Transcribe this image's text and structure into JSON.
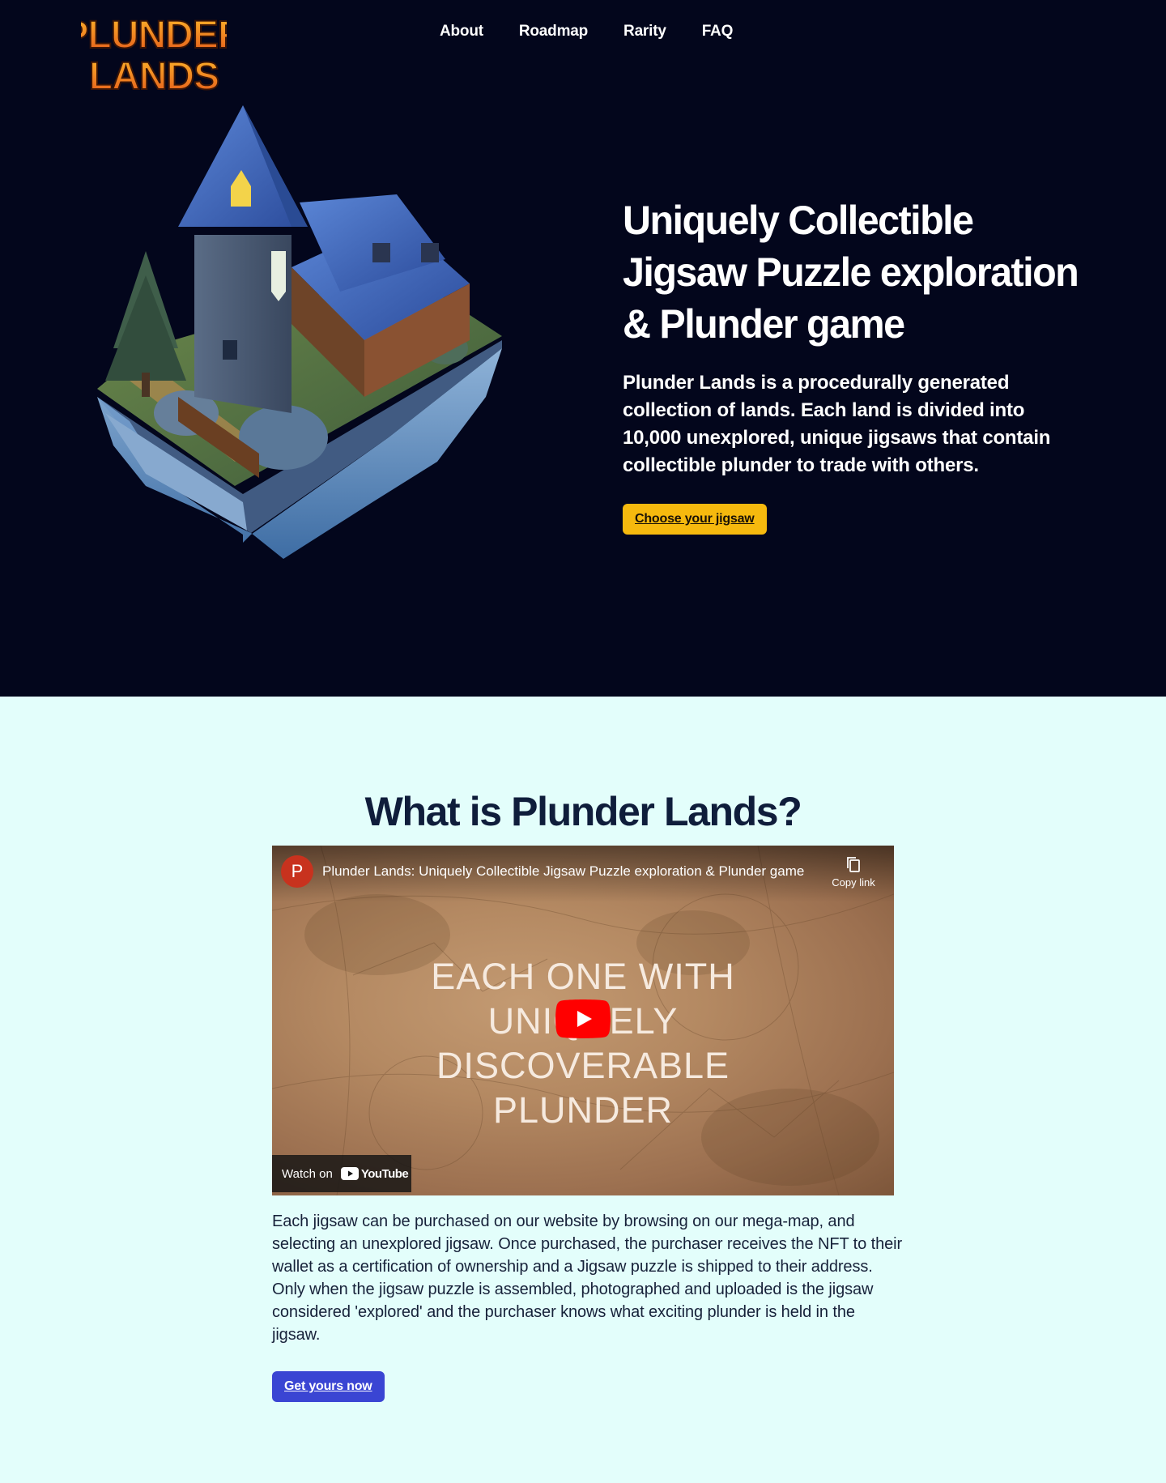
{
  "header": {
    "logo_text": "PLUNDER LANDS",
    "nav": [
      "About",
      "Roadmap",
      "Rarity",
      "FAQ"
    ]
  },
  "hero": {
    "title": "Uniquely Collectible Jigsaw Puzzle exploration & Plunder game",
    "description": "Plunder Lands is a procedurally generated collection of lands. Each land is divided into 10,000 unexplored, unique jigsaws that contain collectible plunder to trade with others.",
    "cta_label": "Choose your jigsaw"
  },
  "about": {
    "title": "What is Plunder Lands?",
    "video": {
      "channel_initial": "P",
      "title": "Plunder Lands: Uniquely Collectible Jigsaw Puzzle exploration & Plunder game",
      "copy_link_label": "Copy link",
      "overlay_text": "EACH ONE WITH UNIQUELY DISCOVERABLE PLUNDER",
      "watch_on_label": "Watch on",
      "youtube_label": "YouTube"
    },
    "body": "Each jigsaw can be purchased on our website by browsing on our mega-map, and selecting an unexplored jigsaw. Once purchased, the purchaser receives the NFT to their wallet as a certification of ownership and a Jigsaw puzzle is shipped to their address. Only when the jigsaw puzzle is assembled, photographed and uploaded is the jigsaw considered 'explored' and the purchaser knows what exciting plunder is held in the jigsaw.",
    "cta_label": "Get yours now"
  },
  "colors": {
    "hero_bg": "#03061c",
    "section_bg": "#e3fefb",
    "accent_yellow": "#f6b90e",
    "accent_blue": "#3a45d3",
    "heading_dark": "#0f1d3b",
    "logo_orange": "#f08a1c"
  }
}
